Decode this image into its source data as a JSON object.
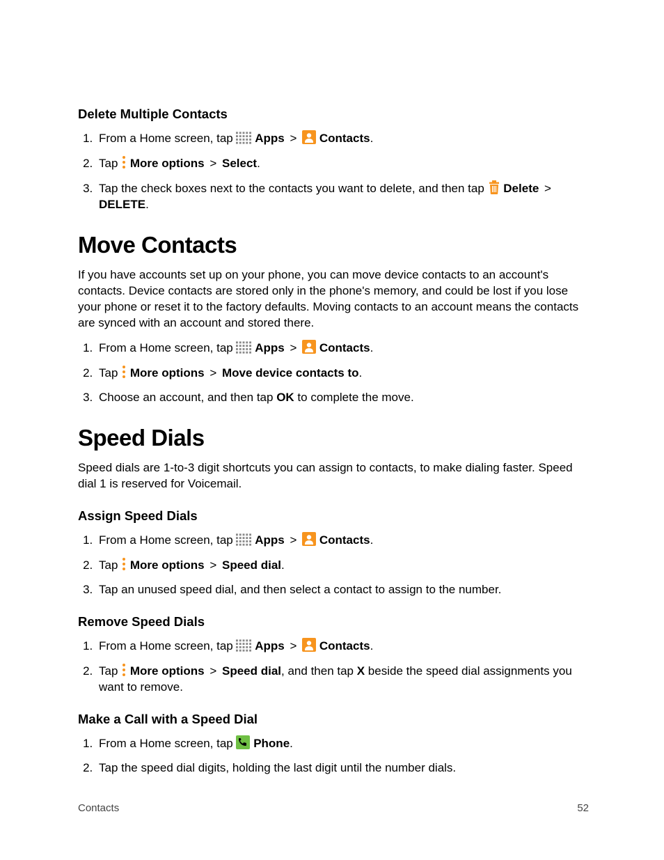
{
  "footer": {
    "section": "Contacts",
    "page": "52"
  },
  "labels": {
    "apps": "Apps",
    "contacts": "Contacts",
    "phone": "Phone",
    "moreOptions": "More options",
    "select": "Select",
    "deleteBold": "Delete",
    "deleteCaps": "DELETE",
    "moveDevice": "Move device contacts to",
    "speedDial": "Speed dial",
    "ok": "OK",
    "x": "X",
    "gt": ">",
    "period": "."
  },
  "s1": {
    "heading": "Delete Multiple Contacts",
    "li1a": "From a Home screen, tap ",
    "li2a": "Tap ",
    "li3a": "Tap the check boxes next to the contacts you want to delete, and then tap "
  },
  "s2": {
    "heading": "Move Contacts",
    "intro": "If you have accounts set up on your phone, you can move device contacts to an account's contacts. Device contacts are stored only in the phone's memory, and could be lost if you lose your phone or reset it to the factory defaults. Moving contacts to an account means the contacts are synced with an account and stored there.",
    "li1a": "From a Home screen, tap ",
    "li2a": "Tap ",
    "li3a": "Choose an account, and then tap ",
    "li3b": " to complete the move."
  },
  "s3": {
    "heading": "Speed Dials",
    "intro": "Speed dials are 1-to-3 digit shortcuts you can assign to contacts, to make dialing faster. Speed dial 1 is reserved for Voicemail."
  },
  "s3a": {
    "heading": "Assign Speed Dials",
    "li1a": "From a Home screen, tap ",
    "li2a": "Tap ",
    "li3": "Tap an unused speed dial, and then select a contact to assign to the number."
  },
  "s3b": {
    "heading": "Remove Speed Dials",
    "li1a": "From a Home screen, tap ",
    "li2a": "Tap ",
    "li2b": ", and then tap ",
    "li2c": " beside the speed dial assignments you want to remove."
  },
  "s3c": {
    "heading": "Make a Call with a Speed Dial",
    "li1a": "From a Home screen, tap ",
    "li2": "Tap the speed dial digits, holding the last digit until the number dials."
  }
}
